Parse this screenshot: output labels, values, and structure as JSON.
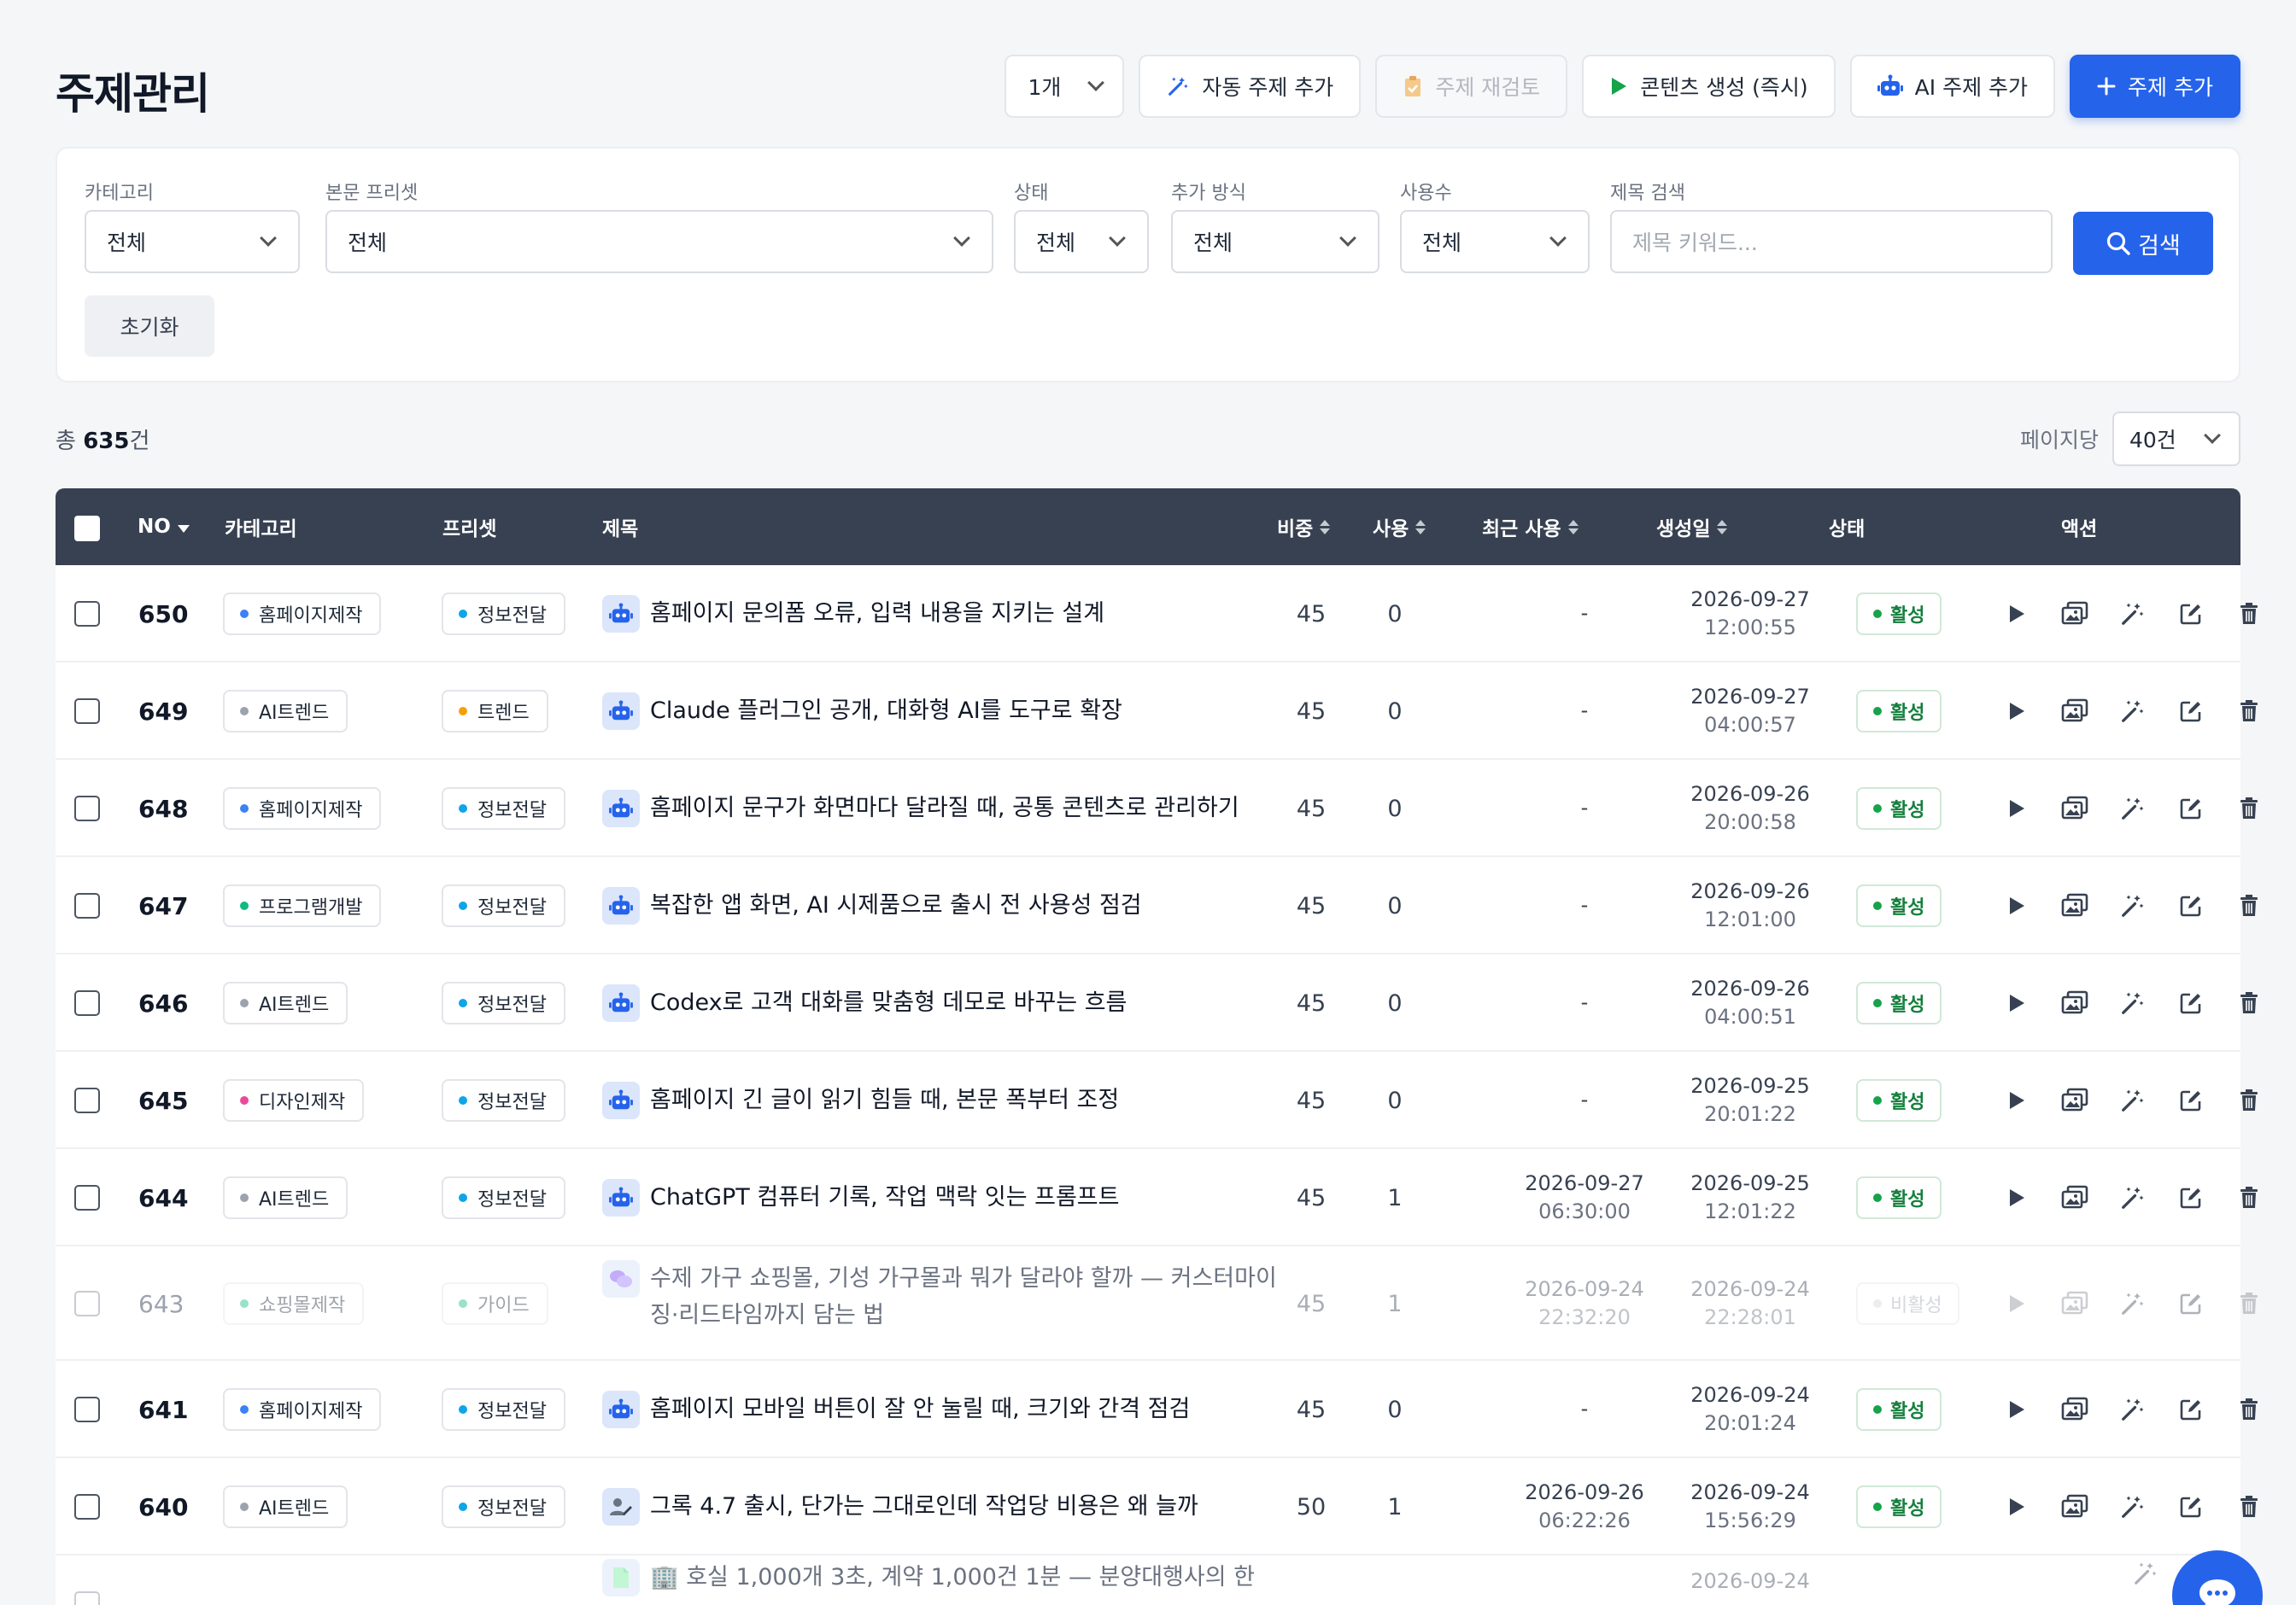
{
  "header": {
    "title": "주제관리",
    "count_select": "1개",
    "auto_add": "자동 주제 추가",
    "review": "주제 재검토",
    "generate": "콘텐츠 생성 (즉시)",
    "ai_add": "AI 주제 추가",
    "add": "주제 추가"
  },
  "filters": {
    "category": {
      "label": "카테고리",
      "value": "전체"
    },
    "preset": {
      "label": "본문 프리셋",
      "value": "전체"
    },
    "status": {
      "label": "상태",
      "value": "전체"
    },
    "method": {
      "label": "추가 방식",
      "value": "전체"
    },
    "usage": {
      "label": "사용수",
      "value": "전체"
    },
    "search": {
      "label": "제목 검색",
      "placeholder": "제목 키워드..."
    },
    "search_button": "검색",
    "reset_button": "초기화"
  },
  "summary": {
    "prefix": "총 ",
    "count": "635",
    "suffix": "건",
    "per_page_label": "페이지당",
    "per_page_value": "40건"
  },
  "columns": {
    "no": "NO",
    "category": "카테고리",
    "preset": "프리셋",
    "title": "제목",
    "weight": "비중",
    "usage": "사용",
    "last_used": "최근 사용",
    "created": "생성일",
    "status": "상태",
    "actions": "액션"
  },
  "colors": {
    "primary": "#2563eb",
    "header_bg": "#374151",
    "active_green": "#16a34a",
    "dot_blue": "#3b82f6",
    "dot_gray": "#9ca3af",
    "dot_green": "#10b981",
    "dot_pink": "#ec4899",
    "dot_orange": "#f59e0b",
    "dot_teal": "#0ea5e9"
  },
  "rows": [
    {
      "no": "650",
      "category": "홈페이지제작",
      "cat_dot": "#3b82f6",
      "preset": "정보전달",
      "preset_dot": "#0ea5e9",
      "icon": "robot-icon",
      "title": "홈페이지 문의폼 오류, 입력 내용을 지키는 설계",
      "weight": "45",
      "usage": "0",
      "last_date": "-",
      "last_time": "",
      "created_date": "2026-09-27",
      "created_time": "12:00:55",
      "status": "활성",
      "inactive": false
    },
    {
      "no": "649",
      "category": "AI트렌드",
      "cat_dot": "#9ca3af",
      "preset": "트렌드",
      "preset_dot": "#f59e0b",
      "icon": "robot-icon",
      "title": "Claude 플러그인 공개, 대화형 AI를 도구로 확장",
      "weight": "45",
      "usage": "0",
      "last_date": "-",
      "last_time": "",
      "created_date": "2026-09-27",
      "created_time": "04:00:57",
      "status": "활성",
      "inactive": false
    },
    {
      "no": "648",
      "category": "홈페이지제작",
      "cat_dot": "#3b82f6",
      "preset": "정보전달",
      "preset_dot": "#0ea5e9",
      "icon": "robot-icon",
      "title": "홈페이지 문구가 화면마다 달라질 때, 공통 콘텐츠로 관리하기",
      "weight": "45",
      "usage": "0",
      "last_date": "-",
      "last_time": "",
      "created_date": "2026-09-26",
      "created_time": "20:00:58",
      "status": "활성",
      "inactive": false
    },
    {
      "no": "647",
      "category": "프로그램개발",
      "cat_dot": "#10b981",
      "preset": "정보전달",
      "preset_dot": "#0ea5e9",
      "icon": "robot-icon",
      "title": "복잡한 앱 화면, AI 시제품으로 출시 전 사용성 점검",
      "weight": "45",
      "usage": "0",
      "last_date": "-",
      "last_time": "",
      "created_date": "2026-09-26",
      "created_time": "12:01:00",
      "status": "활성",
      "inactive": false
    },
    {
      "no": "646",
      "category": "AI트렌드",
      "cat_dot": "#9ca3af",
      "preset": "정보전달",
      "preset_dot": "#0ea5e9",
      "icon": "robot-icon",
      "title": "Codex로 고객 대화를 맞춤형 데모로 바꾸는 흐름",
      "weight": "45",
      "usage": "0",
      "last_date": "-",
      "last_time": "",
      "created_date": "2026-09-26",
      "created_time": "04:00:51",
      "status": "활성",
      "inactive": false
    },
    {
      "no": "645",
      "category": "디자인제작",
      "cat_dot": "#ec4899",
      "preset": "정보전달",
      "preset_dot": "#0ea5e9",
      "icon": "robot-icon",
      "title": "홈페이지 긴 글이 읽기 힘들 때, 본문 폭부터 조정",
      "weight": "45",
      "usage": "0",
      "last_date": "-",
      "last_time": "",
      "created_date": "2026-09-25",
      "created_time": "20:01:22",
      "status": "활성",
      "inactive": false
    },
    {
      "no": "644",
      "category": "AI트렌드",
      "cat_dot": "#9ca3af",
      "preset": "정보전달",
      "preset_dot": "#0ea5e9",
      "icon": "robot-icon",
      "title": "ChatGPT 컴퓨터 기록, 작업 맥락 잇는 프롬프트",
      "weight": "45",
      "usage": "1",
      "last_date": "2026-09-27",
      "last_time": "06:30:00",
      "created_date": "2026-09-25",
      "created_time": "12:01:22",
      "status": "활성",
      "inactive": false
    },
    {
      "no": "643",
      "category": "쇼핑몰제작",
      "cat_dot": "#10b981",
      "preset": "가이드",
      "preset_dot": "#10b981",
      "icon": "chat-icon",
      "title": "수제 가구 쇼핑몰, 기성 가구몰과 뭐가 달라야 할까 — 커스터마이징·리드타임까지 담는 법",
      "weight": "45",
      "usage": "1",
      "last_date": "2026-09-24",
      "last_time": "22:32:20",
      "created_date": "2026-09-24",
      "created_time": "22:28:01",
      "status": "비활성",
      "inactive": true
    },
    {
      "no": "641",
      "category": "홈페이지제작",
      "cat_dot": "#3b82f6",
      "preset": "정보전달",
      "preset_dot": "#0ea5e9",
      "icon": "robot-icon",
      "title": "홈페이지 모바일 버튼이 잘 안 눌릴 때, 크기와 간격 점검",
      "weight": "45",
      "usage": "0",
      "last_date": "-",
      "last_time": "",
      "created_date": "2026-09-24",
      "created_time": "20:01:24",
      "status": "활성",
      "inactive": false
    },
    {
      "no": "640",
      "category": "AI트렌드",
      "cat_dot": "#9ca3af",
      "preset": "정보전달",
      "preset_dot": "#0ea5e9",
      "icon": "user-edit-icon",
      "title": "그록 4.7 출시, 단가는 그대로인데 작업당 비용은 왜 늘까",
      "weight": "50",
      "usage": "1",
      "last_date": "2026-09-26",
      "last_time": "06:22:26",
      "created_date": "2026-09-24",
      "created_time": "15:56:29",
      "status": "활성",
      "inactive": false
    },
    {
      "no": "",
      "category": "",
      "cat_dot": "#9ca3af",
      "preset": "",
      "preset_dot": "#0ea5e9",
      "icon": "document-icon",
      "title": "🏢 호실 1,000개 3초, 계약 1,000건 1분 — 분양대행사의 한",
      "weight": "",
      "usage": "",
      "last_date": "",
      "last_time": "",
      "created_date": "2026-09-24",
      "created_time": "",
      "status": "",
      "inactive": true
    }
  ]
}
